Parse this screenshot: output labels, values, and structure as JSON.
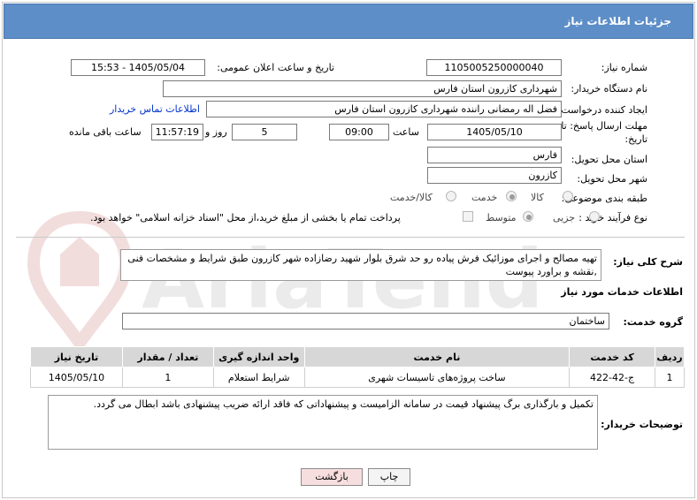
{
  "page": {
    "title": "جزئیات اطلاعات نیاز"
  },
  "form": {
    "need_number_label": "شماره نیاز:",
    "need_number": "1105005250000040",
    "announce_label": "تاریخ و ساعت اعلان عمومی:",
    "announce_value": "1405/05/04 - 15:53",
    "buyer_org_label": "نام دستگاه خریدار:",
    "buyer_org": "شهرداری کازرون استان فارس",
    "creator_label": "ایجاد کننده درخواست:",
    "creator": "فضل اله رمضانی راننده شهرداری کازرون استان فارس",
    "contact_link": "اطلاعات تماس خریدار",
    "deadline_label_1": "مهلت ارسال پاسخ: تا",
    "deadline_label_2": "تاریخ:",
    "deadline_date": "1405/05/10",
    "time_label": "ساعت",
    "deadline_time": "09:00",
    "days_value": "5",
    "days_label": "روز و",
    "remaining_time": "11:57:19",
    "remaining_label": "ساعت باقی مانده",
    "province_label": "استان محل تحویل:",
    "province": "فارس",
    "city_label": "شهر محل تحویل:",
    "city": "کازرون",
    "category_label": "طبقه بندی موضوعی:",
    "category_options": [
      "کالا",
      "خدمت",
      "کالا/خدمت"
    ],
    "category_selected": 1,
    "process_label": "نوع فرآیند خرید :",
    "process_options": [
      "جزیی",
      "متوسط"
    ],
    "process_selected": 1,
    "payment_note": "پرداخت تمام یا بخشی از مبلغ خرید،از محل \"اسناد خزانه اسلامی\" خواهد بود."
  },
  "description": {
    "label": "شرح کلی نیاز:",
    "text": "تهیه مصالح و اجرای موزائیک فرش پیاده رو حد شرق بلوار شهید رضازاده شهر کازرون طبق شرایط و مشخصات فنی ,نقشه و براورد پیوست"
  },
  "services": {
    "section_title": "اطلاعات خدمات مورد نیاز",
    "group_label": "گروه خدمت:",
    "group_value": "ساختمان",
    "columns": [
      "ردیف",
      "کد خدمت",
      "نام خدمت",
      "واحد اندازه گیری",
      "تعداد / مقدار",
      "تاریخ نیاز"
    ],
    "rows": [
      [
        "1",
        "ج-42-422",
        "ساخت پروژه‌های تاسیسات شهری",
        "شرایط استعلام",
        "1",
        "1405/05/10"
      ]
    ]
  },
  "buyer_notes": {
    "label": "توضیحات خریدار:",
    "text": "تکمیل و بارگذاری برگ پیشنهاد قیمت در سامانه الزامیست و پیشنهاداتی که فاقد ارائه ضریب پیشنهادی باشد ابطال می گردد."
  },
  "buttons": {
    "print": "چاپ",
    "back": "بازگشت"
  },
  "watermark": {
    "text": "AriaTender.neT"
  },
  "colors": {
    "header": "#5d8ec8",
    "link": "#0033cc",
    "table_header": "#d7d7d7"
  }
}
